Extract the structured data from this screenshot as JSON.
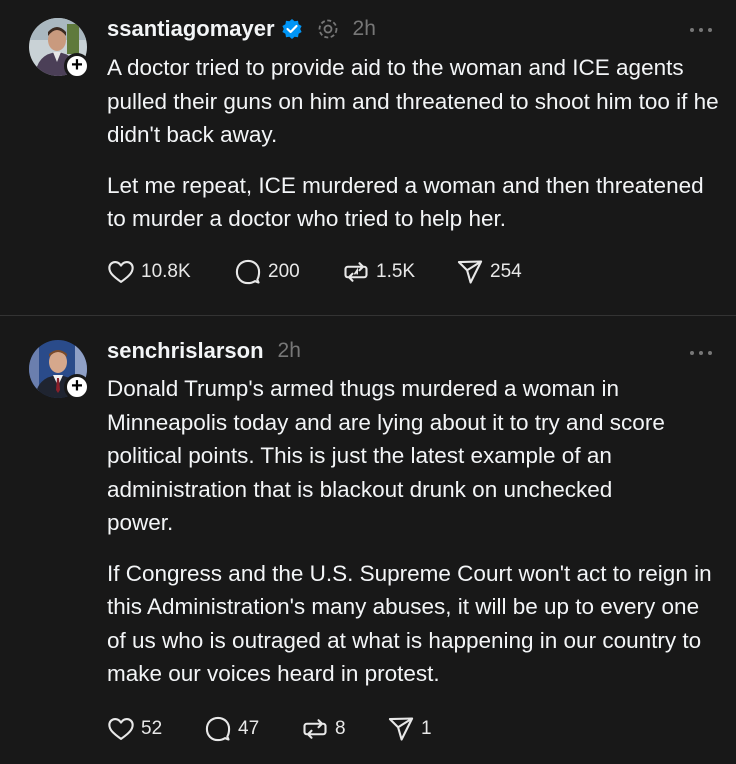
{
  "posts": [
    {
      "username": "ssantiagomayer",
      "verified": true,
      "time": "2h",
      "paragraphs": [
        "A doctor tried to provide aid to the woman and ICE agents pulled their guns on him and threatened to shoot him too if he didn't back away.",
        "Let me repeat, ICE murdered a woman and then threatened to murder a doctor who tried to help her."
      ],
      "actions": {
        "likes": "10.8K",
        "replies": "200",
        "reposts": "1.5K",
        "shares": "254"
      }
    },
    {
      "username": "senchrislarson",
      "verified": false,
      "time": "2h",
      "paragraphs": [
        "Donald Trump's armed thugs murdered a woman in Minneapolis today and are lying about it to try and score political points. This is just the latest example of an administration that is blackout drunk on unchecked power.",
        "If Congress and the U.S. Supreme Court won't act to reign in this Administration's many abuses, it will be up to every one of us who is outraged at what is happening in our country to make our voices heard in protest."
      ],
      "actions": {
        "likes": "52",
        "replies": "47",
        "reposts": "8",
        "shares": "1"
      }
    }
  ],
  "icons": {
    "like": "heart-icon",
    "reply": "speech-bubble-icon",
    "repost": "repost-arrows-icon",
    "share": "paper-plane-icon",
    "more": "more-dots-icon",
    "verified": "verified-badge-icon"
  },
  "colors": {
    "background": "#181818",
    "text": "#f3f5f7",
    "muted": "#777777",
    "verified": "#0095f6"
  }
}
